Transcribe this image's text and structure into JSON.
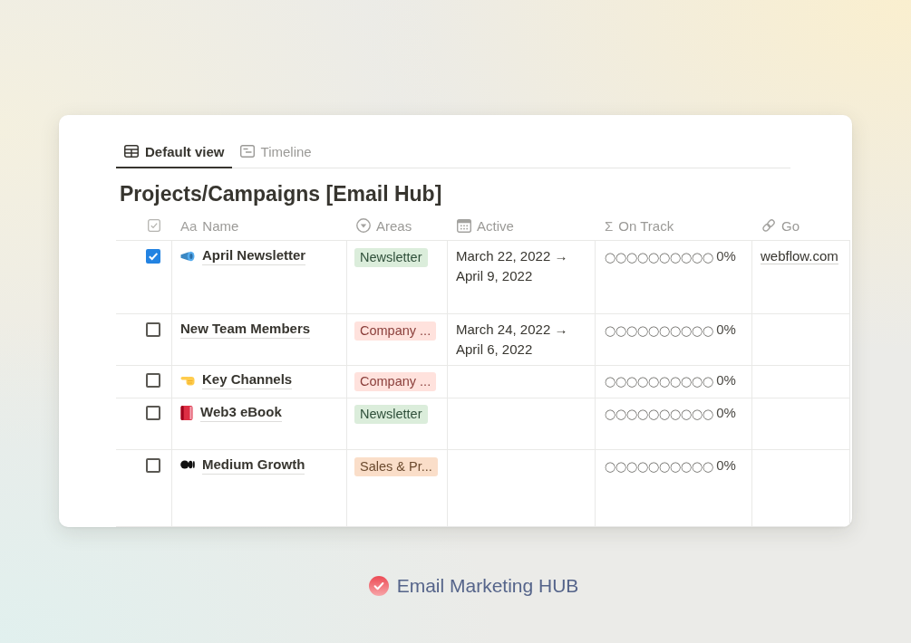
{
  "tabs": [
    {
      "label": "Default view",
      "kind": "table",
      "selected": true
    },
    {
      "label": "Timeline",
      "kind": "timeline",
      "selected": false
    }
  ],
  "title": "Projects/Campaigns [Email Hub]",
  "columns": [
    {
      "kind": "checkbox"
    },
    {
      "kind": "title",
      "glyph": "Aa",
      "label": "Name"
    },
    {
      "kind": "select",
      "label": "Areas"
    },
    {
      "kind": "date",
      "label": "Active"
    },
    {
      "kind": "formula",
      "glyph": "Σ",
      "label": "On Track"
    },
    {
      "kind": "url",
      "label": "Go"
    }
  ],
  "rows": [
    {
      "kind": "megaphone",
      "checked": true,
      "name": "April Newsletter",
      "area": {
        "label": "Newsletter",
        "color": "#dbeddb"
      },
      "active": "March 22, 2022 → April 9, 2022",
      "on_track": "◯◯◯◯◯◯◯◯◯◯ 0%",
      "go": "webflow.com"
    },
    {
      "kind": "plain",
      "checked": false,
      "name": "New Team Members",
      "area": {
        "label": "Company ...",
        "color": "#ffe2dd"
      },
      "active": "March 24, 2022 → April 6, 2022",
      "on_track": "◯◯◯◯◯◯◯◯◯◯ 0%"
    },
    {
      "kind": "hand",
      "checked": false,
      "name": "Key Channels",
      "area": {
        "label": "Company ...",
        "color": "#ffe2dd"
      },
      "on_track": "◯◯◯◯◯◯◯◯◯◯ 0%"
    },
    {
      "kind": "book",
      "checked": false,
      "name": "Web3 eBook",
      "area": {
        "label": "Newsletter",
        "color": "#dbeddb"
      },
      "on_track": "◯◯◯◯◯◯◯◯◯◯ 0%"
    },
    {
      "kind": "dots",
      "checked": false,
      "name": "Medium Growth",
      "area": {
        "label": "Sales & Pr...",
        "color": "#fadec9"
      },
      "on_track": "◯◯◯◯◯◯◯◯◯◯ 0%"
    }
  ],
  "footer": {
    "label": "Email Marketing HUB"
  }
}
